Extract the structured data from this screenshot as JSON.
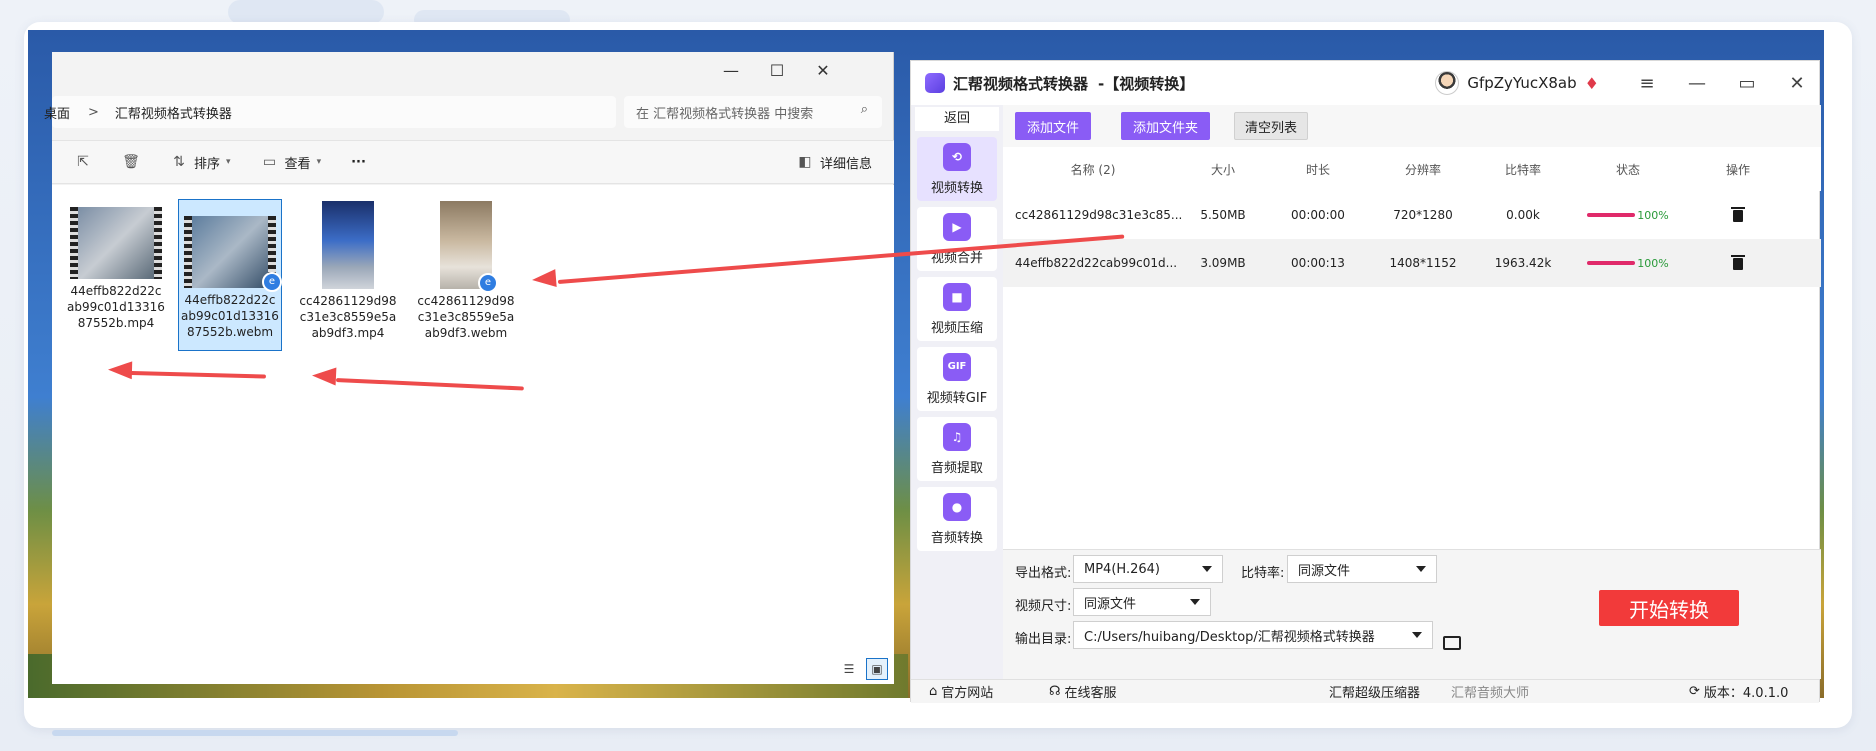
{
  "explorer": {
    "breadcrumb_prev": "桌面",
    "breadcrumb_sep": ">",
    "breadcrumb_current": "汇帮视频格式转换器",
    "search_placeholder": "在 汇帮视频格式转换器 中搜索",
    "toolbar": {
      "sort": "排序",
      "view": "查看",
      "more": "···",
      "details": "详细信息"
    },
    "files": [
      {
        "name": "44effb822d22cab99c01d1331687552b.mp4",
        "line1": "44effb822d22c",
        "line2": "ab99c01d13316",
        "line3": "87552b.mp4"
      },
      {
        "name": "44effb822d22cab99c01d1331687552b.webm",
        "line1": "44effb822d22c",
        "line2": "ab99c01d13316",
        "line3": "87552b.webm"
      },
      {
        "name": "cc42861129d98c31e3c8559e5aab9df3.mp4",
        "line1": "cc42861129d98",
        "line2": "c31e3c8559e5a",
        "line3": "ab9df3.mp4"
      },
      {
        "name": "cc42861129d98c31e3c8559e5aab9df3.webm",
        "line1": "cc42861129d98",
        "line2": "c31e3c8559e5a",
        "line3": "ab9df3.webm"
      }
    ]
  },
  "app": {
    "title": "汇帮视频格式转换器",
    "title_suffix": "-【视频转换】",
    "username": "GfpZyYucX8ab",
    "back": "返回",
    "nav": [
      {
        "label": "视频转换",
        "icon": "video-convert-icon"
      },
      {
        "label": "视频合并",
        "icon": "video-merge-icon"
      },
      {
        "label": "视频压缩",
        "icon": "video-compress-icon"
      },
      {
        "label": "视频转GIF",
        "icon": "gif-icon",
        "icon_text": "GIF"
      },
      {
        "label": "音频提取",
        "icon": "music-note-icon"
      },
      {
        "label": "音频转换",
        "icon": "microphone-icon"
      }
    ],
    "buttons": {
      "add_file": "添加文件",
      "add_folder": "添加文件夹",
      "clear_list": "清空列表"
    },
    "table": {
      "headers": [
        "名称 (2)",
        "大小",
        "时长",
        "分辨率",
        "比特率",
        "状态",
        "操作"
      ],
      "rows": [
        {
          "name": "cc42861129d98c31e3c85...",
          "size": "5.50MB",
          "duration": "00:00:00",
          "resolution": "720*1280",
          "bitrate": "0.00k",
          "status": "100%"
        },
        {
          "name": "44effb822d22cab99c01d...",
          "size": "3.09MB",
          "duration": "00:00:13",
          "resolution": "1408*1152",
          "bitrate": "1963.42k",
          "status": "100%"
        }
      ]
    },
    "settings": {
      "format_label": "导出格式:",
      "format_value": "MP4(H.264)",
      "bitrate_label": "比特率:",
      "bitrate_value": "同源文件",
      "size_label": "视频尺寸:",
      "size_value": "同源文件",
      "output_label": "输出目录:",
      "output_value": "C:/Users/huibang/Desktop/汇帮视频格式转换器",
      "start": "开始转换"
    },
    "footer": {
      "website": "官方网站",
      "support": "在线客服",
      "link1": "汇帮超级压缩器",
      "link2": "汇帮音频大师",
      "version": "版本：4.0.1.0"
    }
  },
  "colors": {
    "accent": "#8a5cf5",
    "start": "#f23a3a",
    "arrow": "#ee4b4b",
    "progress": "#e02a6a"
  }
}
